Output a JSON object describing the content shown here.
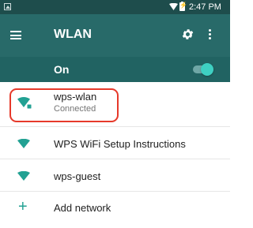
{
  "status_bar": {
    "time": "2:47 PM"
  },
  "toolbar": {
    "title": "WLAN"
  },
  "switch_bar": {
    "label": "On",
    "enabled": true
  },
  "networks": [
    {
      "name": "wps-wlan",
      "status": "Connected",
      "icon": "wifi-secured-icon"
    },
    {
      "name": "WPS WiFi Setup Instructions",
      "icon": "wifi-icon"
    },
    {
      "name": "wps-guest",
      "icon": "wifi-icon"
    }
  ],
  "add_network": {
    "label": "Add network",
    "icon": "plus-icon"
  },
  "colors": {
    "status_bar": "#1e4d4c",
    "toolbar": "#286a69",
    "switch_bar": "#216362",
    "accent": "#22a193",
    "highlight": "#e6392a"
  }
}
